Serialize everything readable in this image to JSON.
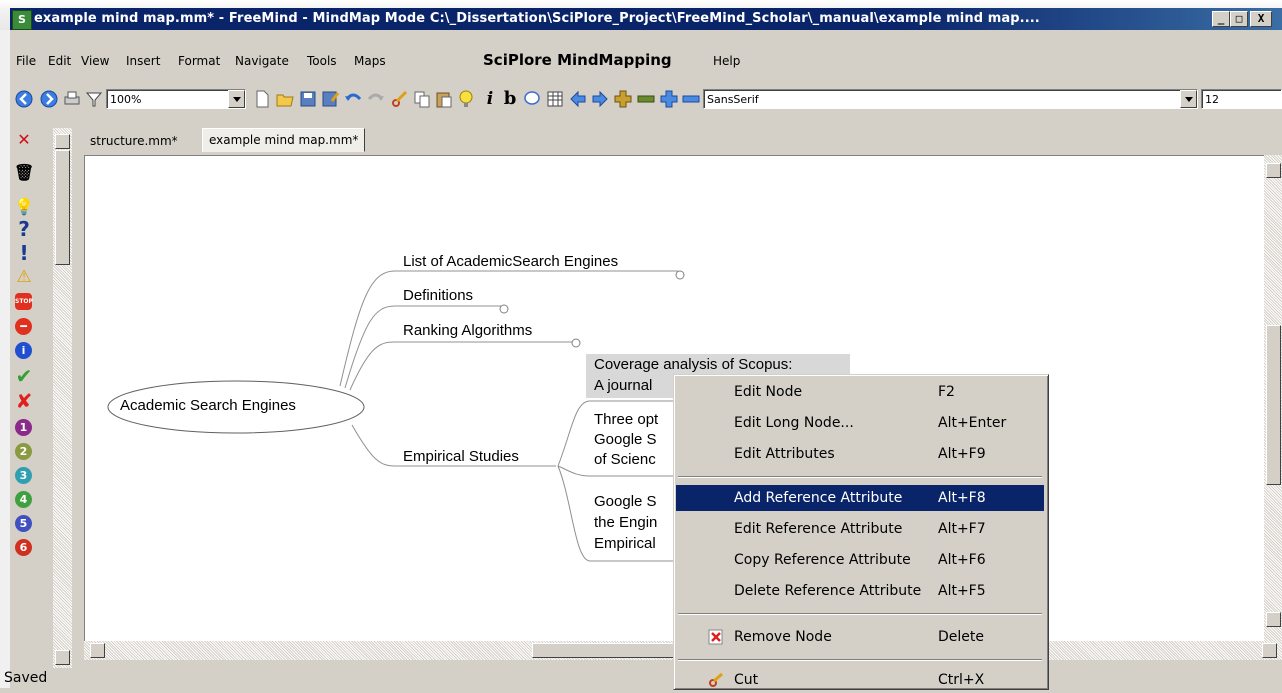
{
  "window": {
    "title": "example mind map.mm* - FreeMind - MindMap Mode C:\\_Dissertation\\SciPlore_Project\\FreeMind_Scholar\\_manual\\example mind map....",
    "icon_label": "S",
    "buttons": {
      "minimize": "_",
      "maximize": "□",
      "close": "X"
    }
  },
  "menubar": {
    "items": [
      "File",
      "Edit",
      "View",
      "Insert",
      "Format",
      "Navigate",
      "Tools",
      "Maps"
    ],
    "brand": "SciPlore MindMapping",
    "help": "Help"
  },
  "toolbar": {
    "zoom": "100%",
    "font_family": "SansSerif",
    "font_size": "12"
  },
  "tabs": [
    "structure.mm*",
    "example mind map.mm*"
  ],
  "mindmap": {
    "root": "Academic Search Engines",
    "branches": [
      "List of AcademicSearch Engines",
      "Definitions",
      "Ranking Algorithms",
      "Empirical Studies"
    ],
    "children": [
      {
        "line1": "Coverage analysis of Scopus:",
        "line2": "A journal"
      },
      {
        "line1": "Three opt",
        "line2": "Google S",
        "line3": "of Scienc"
      },
      {
        "line1": "Google S",
        "line2": "the Engin",
        "line3": "Empirical"
      }
    ]
  },
  "context_menu": {
    "items": [
      {
        "label": "Edit Node",
        "key": "F2"
      },
      {
        "label": "Edit Long Node...",
        "key": "Alt+Enter"
      },
      {
        "label": "Edit Attributes",
        "key": "Alt+F9"
      },
      {
        "label": "Add Reference Attribute",
        "key": "Alt+F8"
      },
      {
        "label": "Edit Reference Attribute",
        "key": "Alt+F7"
      },
      {
        "label": "Copy Reference Attribute",
        "key": "Alt+F6"
      },
      {
        "label": "Delete Reference Attribute",
        "key": "Alt+F5"
      },
      {
        "label": "Remove Node",
        "key": "Delete"
      },
      {
        "label": "Cut",
        "key": "Ctrl+X"
      }
    ],
    "selected": "Add Reference Attribute"
  },
  "status": "Saved",
  "colors": {
    "titlebar": "#0a246a",
    "selection": "#0a246a",
    "chrome": "#d4d0c8"
  }
}
